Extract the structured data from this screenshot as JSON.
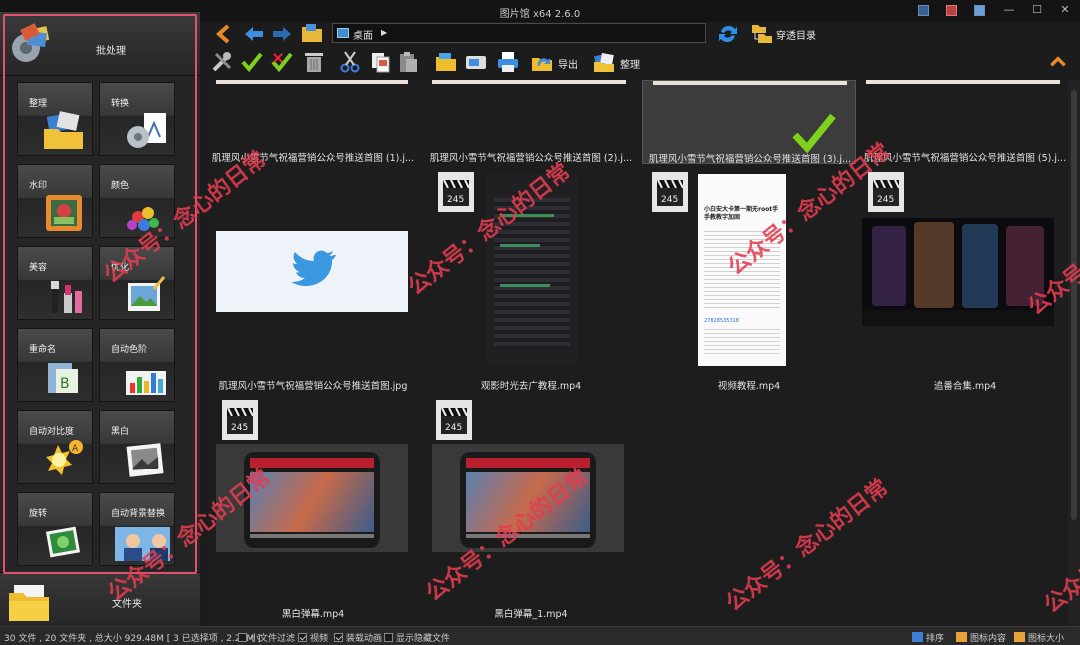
{
  "window": {
    "title": "图片馆 x64 2.6.0"
  },
  "sidebar": {
    "batch_label": "批处理",
    "tiles": [
      {
        "label": "整理",
        "icon": "folder-photos-icon"
      },
      {
        "label": "转换",
        "icon": "convert-icon"
      },
      {
        "label": "水印",
        "icon": "watermark-icon"
      },
      {
        "label": "颜色",
        "icon": "color-palette-icon"
      },
      {
        "label": "美容",
        "icon": "cosmetics-icon"
      },
      {
        "label": "优化",
        "icon": "optimize-icon"
      },
      {
        "label": "重命名",
        "icon": "rename-icon"
      },
      {
        "label": "自动色阶",
        "icon": "auto-levels-icon"
      },
      {
        "label": "自动对比度",
        "icon": "auto-contrast-icon"
      },
      {
        "label": "黑白",
        "icon": "black-white-icon"
      },
      {
        "label": "旋转",
        "icon": "rotate-icon"
      },
      {
        "label": "自动背景替换",
        "icon": "background-replace-icon"
      }
    ],
    "folder_label": "文件夹"
  },
  "toolbar": {
    "path": "桌面",
    "through_dir_label": "穿透目录",
    "export_label": "导出",
    "organize_label": "整理"
  },
  "files": [
    {
      "caption": "肌理风小雪节气祝福营销公众号推送首图 (1).j...",
      "kind": "image-top"
    },
    {
      "caption": "肌理风小雪节气祝福营销公众号推送首图 (2).j...",
      "kind": "image-top"
    },
    {
      "caption": "肌理风小雪节气祝福营销公众号推送首图 (3).j...",
      "kind": "image-top-selected"
    },
    {
      "caption": "肌理风小雪节气祝福营销公众号推送首图 (5).j...",
      "kind": "image-top"
    },
    {
      "caption": "肌理风小雪节气祝福营销公众号推送首图.jpg",
      "kind": "twitter"
    },
    {
      "caption": "观影时光去广教程.mp4",
      "kind": "video-phone-code"
    },
    {
      "caption": "视频教程.mp4",
      "kind": "video-article"
    },
    {
      "caption": "追番合集.mp4",
      "kind": "video-anime"
    },
    {
      "caption": "黑白弹幕.mp4",
      "kind": "video-game"
    },
    {
      "caption": "黑白弹幕_1.mp4",
      "kind": "video-game"
    }
  ],
  "article_thumb": {
    "title": "小白安大卡第一期无root手手教教字加固",
    "link": "27828535318"
  },
  "status": {
    "summary": "30 文件 , 20 文件夹 , 总大小 929.48M [ 3 已选择项 , 2.24M ]",
    "small_file_filter": "小文件过滤",
    "video": "视频",
    "load_animation": "装载动画",
    "show_hidden": "显示隐藏文件",
    "sort": "排序",
    "icon_content": "图标内容",
    "icon_size": "图标大小"
  },
  "watermark": {
    "text": "公众号：念心的日常"
  },
  "colors": {
    "accent_red": "#e0536e",
    "selection": "#3c3c3c",
    "check_green": "#7fd21a"
  }
}
